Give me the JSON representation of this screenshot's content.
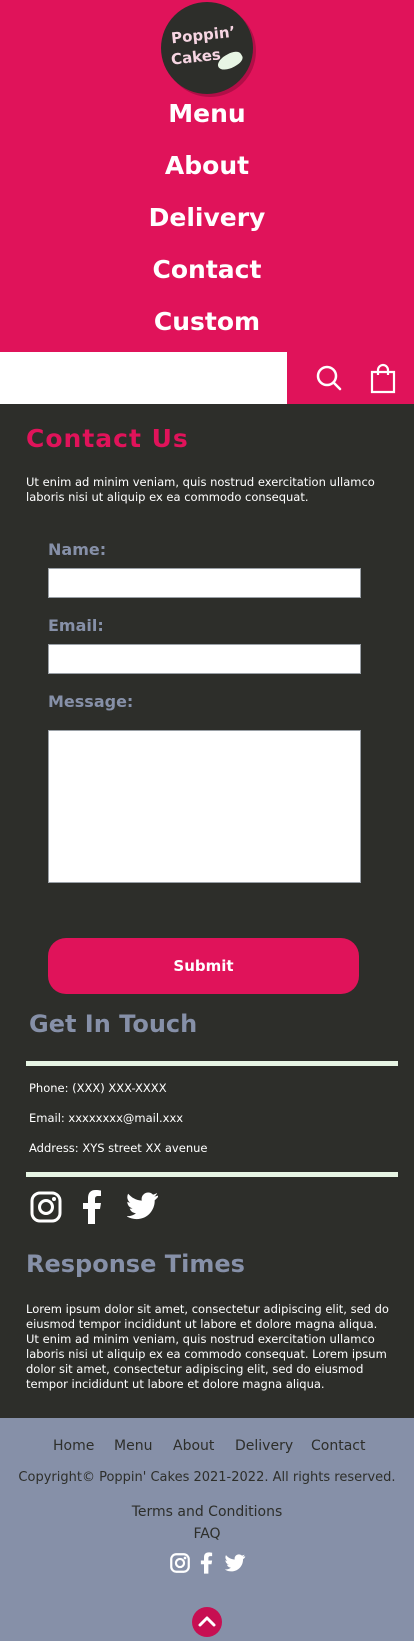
{
  "brand": {
    "logo_line1": "Poppin’",
    "logo_line2": "Cakes"
  },
  "nav": {
    "items": [
      "Menu",
      "About",
      "Delivery",
      "Contact",
      "Custom"
    ]
  },
  "search": {
    "placeholder": ""
  },
  "icons": {
    "search": "search-icon",
    "cart": "shopping-bag-icon"
  },
  "contact": {
    "title": "Contact Us",
    "intro": "Ut enim ad minim veniam, quis nostrud exercitation ullamco laboris nisi ut aliquip ex ea commodo consequat.",
    "form": {
      "name_label": "Name:",
      "email_label": "Email:",
      "message_label": "Message:",
      "submit_label": "Submit"
    }
  },
  "touch": {
    "title": "Get In Touch",
    "phone": "Phone: (XXX) XXX-XXXX",
    "email": "Email: xxxxxxxx@mail.xxx",
    "address": "Address: XYS street XX avenue"
  },
  "social": [
    "instagram-icon",
    "facebook-icon",
    "twitter-icon"
  ],
  "response": {
    "title": "Response Times",
    "text": "Lorem ipsum dolor sit amet, consectetur adipiscing elit, sed do eiusmod tempor incididunt ut labore et dolore magna aliqua. Ut enim ad minim veniam, quis nostrud exercitation ullamco laboris nisi ut aliquip ex ea commodo consequat. Lorem ipsum dolor sit amet, consectetur adipiscing elit, sed do eiusmod tempor incididunt ut labore et dolore magna aliqua."
  },
  "footer": {
    "nav": [
      "Home",
      "Menu",
      "About",
      "Delivery",
      "Contact"
    ],
    "copyright": "Copyright© Poppin' Cakes 2021-2022. All rights reserved.",
    "terms": "Terms and Conditions",
    "faq": "FAQ"
  },
  "colors": {
    "brand_pink": "#e0135a",
    "dark_bg": "#2d2e2a",
    "slate": "#8690a8",
    "mint": "#e7f5e4"
  }
}
